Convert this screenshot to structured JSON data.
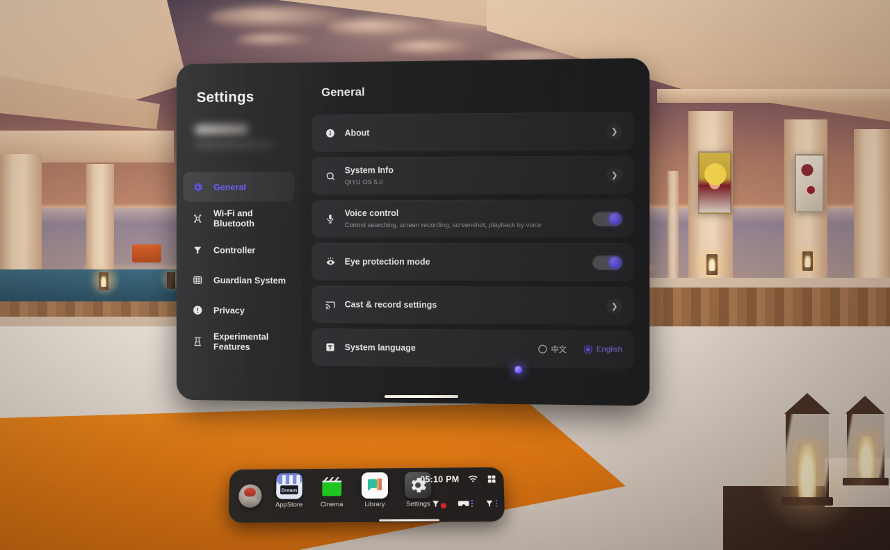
{
  "environment": {
    "name": "vr-home-sunset-villa",
    "description": "Sunset seaside villa VR home environment with columns, pop-art paintings, lanterns, pool and orange rug"
  },
  "settings_panel": {
    "title": "Settings",
    "account": {
      "redacted": true
    },
    "sidebar": {
      "items": [
        {
          "label": "General",
          "icon": "gear-icon",
          "active": true
        },
        {
          "label": "Wi-Fi and Bluetooth",
          "icon": "bluetooth-wifi-icon",
          "active": false
        },
        {
          "label": "Controller",
          "icon": "controller-icon",
          "active": false
        },
        {
          "label": "Guardian System",
          "icon": "guardian-grid-icon",
          "active": false
        },
        {
          "label": "Privacy",
          "icon": "privacy-exclamation-icon",
          "active": false
        },
        {
          "label": "Experimental Features",
          "icon": "flask-icon",
          "active": false
        }
      ]
    },
    "content": {
      "title": "General",
      "rows": [
        {
          "id": "about",
          "title": "About",
          "subtitle": "",
          "icon": "info-icon",
          "control": "chevron"
        },
        {
          "id": "system-info",
          "title": "System Info",
          "subtitle": "QIYU OS 5.0",
          "icon": "system-info-icon",
          "control": "chevron"
        },
        {
          "id": "voice-control",
          "title": "Voice control",
          "subtitle": "Control searching, screen recording, screenshot, playback by voice",
          "icon": "microphone-icon",
          "control": "toggle",
          "toggle_on": true
        },
        {
          "id": "eye-protection-mode",
          "title": "Eye protection mode",
          "subtitle": "",
          "icon": "eye-icon",
          "control": "toggle",
          "toggle_on": true
        },
        {
          "id": "cast-record-settings",
          "title": "Cast & record settings",
          "subtitle": "",
          "icon": "cast-icon",
          "control": "chevron"
        },
        {
          "id": "system-language",
          "title": "System language",
          "subtitle": "",
          "icon": "language-text-icon",
          "control": "radio-group",
          "options": [
            {
              "label": "中文",
              "selected": false
            },
            {
              "label": "English",
              "selected": true
            }
          ]
        }
      ]
    }
  },
  "taskbar": {
    "avatar": "user-avatar",
    "apps": [
      {
        "label": "AppStore",
        "icon": "appstore-icon",
        "badge_text": "Dream"
      },
      {
        "label": "Cinema",
        "icon": "cinema-clapperboard-icon"
      },
      {
        "label": "Library",
        "icon": "library-icon"
      },
      {
        "label": "Settings",
        "icon": "settings-gear-icon"
      }
    ],
    "status": {
      "time": "05:10 PM",
      "wifi": "wifi-icon",
      "apps_grid": "apps-grid-icon",
      "controller_left": "controller-left-icon",
      "headset": "headset-icon",
      "controller_right": "controller-right-icon"
    }
  },
  "colors": {
    "accent_purple": "#6b5cf5",
    "panel_bg": "#2b2b2d",
    "row_bg": "#333336",
    "text_primary": "#f1f1f3",
    "text_secondary": "#9b9b9f",
    "battery_warning": "#cf2a2a"
  }
}
